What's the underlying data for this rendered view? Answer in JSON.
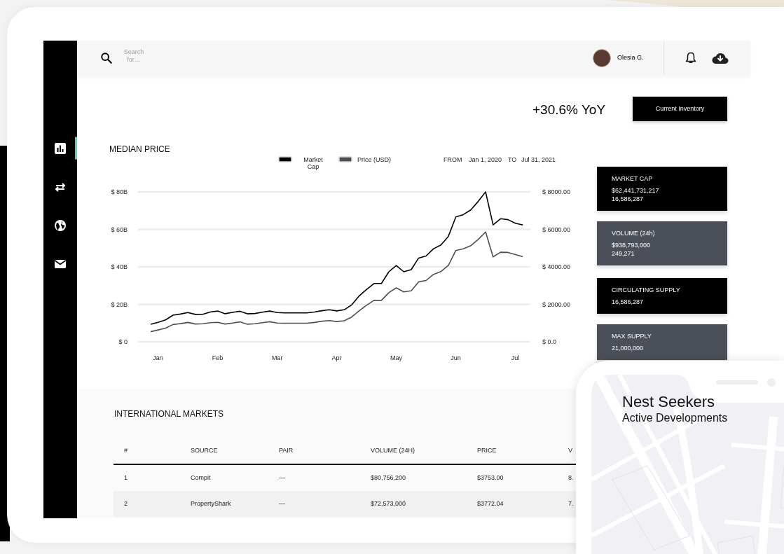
{
  "header": {
    "search": {
      "placeholder": "Search for…"
    },
    "user": {
      "name": "Olesia G."
    }
  },
  "sidebar": {
    "items": [
      {
        "kind": "chart",
        "selected": true
      },
      {
        "kind": "transfer",
        "selected": false
      },
      {
        "kind": "globe",
        "selected": false
      },
      {
        "kind": "mail",
        "selected": false
      }
    ]
  },
  "summary": {
    "change": "+30.6% YoY",
    "button": "Current Inventory"
  },
  "chart": {
    "title": "MEDIAN PRICE",
    "range": {
      "from_label": "FROM",
      "from": "Jan 1, 2020",
      "to_label": "TO",
      "to": "Jul 31, 2021"
    },
    "chart_data": {
      "type": "line",
      "grid": true,
      "legend": true,
      "categories": [
        null,
        "Jan",
        null,
        null,
        null,
        null,
        null,
        null,
        null,
        "Feb",
        null,
        null,
        null,
        null,
        null,
        null,
        null,
        "Mar",
        null,
        null,
        null,
        null,
        null,
        null,
        null,
        "Apr",
        null,
        null,
        null,
        null,
        null,
        null,
        null,
        "May",
        null,
        null,
        null,
        null,
        null,
        null,
        null,
        "Jun",
        null,
        null,
        null,
        null,
        null,
        null,
        null,
        "Jul",
        null
      ],
      "series": [
        {
          "name": "Market Cap",
          "color": "#000000",
          "values": [
            9.3,
            10.4,
            11.7,
            14.2,
            14.8,
            15.6,
            14.6,
            14.7,
            15.9,
            16.4,
            15.0,
            15.7,
            16.3,
            14.9,
            15.1,
            15.8,
            16.4,
            15.6,
            15.4,
            15.4,
            15.4,
            15.4,
            15.9,
            16.6,
            17.1,
            16.5,
            17.1,
            19.7,
            24.4,
            27.9,
            31.1,
            31.1,
            37.4,
            40.7,
            37.4,
            38.5,
            44.7,
            45.8,
            49.7,
            51.7,
            56.3,
            66.6,
            67.9,
            70.4,
            74.9,
            80.0,
            62.4,
            65.7,
            65.2,
            63.3,
            62.3
          ]
        },
        {
          "name": "Price (USD)",
          "color": "#4b5058",
          "axis": "y2",
          "values": [
            540,
            630,
            730,
            920,
            970,
            1030,
            950,
            960,
            1020,
            1040,
            950,
            1000,
            1060,
            940,
            960,
            1020,
            1070,
            1000,
            990,
            990,
            990,
            990,
            1030,
            1100,
            1130,
            1080,
            1120,
            1320,
            1650,
            1950,
            2210,
            2210,
            2620,
            2880,
            2660,
            2720,
            3200,
            3270,
            3600,
            3750,
            4080,
            4870,
            4960,
            5130,
            5460,
            5860,
            4530,
            4780,
            4770,
            4650,
            4540
          ]
        }
      ],
      "ylim": [
        0,
        80
      ],
      "yticks": [
        {
          "value": 0,
          "label": "$ 0"
        },
        {
          "value": 20,
          "label": "$ 20B"
        },
        {
          "value": 40,
          "label": "$ 40B"
        },
        {
          "value": 60,
          "label": "$ 60B"
        },
        {
          "value": 80,
          "label": "$ 80B"
        }
      ],
      "y2lim": [
        0,
        8000
      ],
      "y2ticks": [
        {
          "value": 0,
          "label": "$ 0.0"
        },
        {
          "value": 2000,
          "label": "$ 2000.00"
        },
        {
          "value": 4000,
          "label": "$ 4000.00"
        },
        {
          "value": 6000,
          "label": "$ 6000.00"
        },
        {
          "value": 8000,
          "label": "$ 8000.00"
        }
      ]
    }
  },
  "stats": [
    {
      "label": "MARKET CAP",
      "lines": [
        "$62,441,731,217",
        "16,586,287"
      ],
      "color": "#000000"
    },
    {
      "label": "VOLUME (24h)",
      "lines": [
        "$938,793,000",
        "249,271"
      ],
      "color": "#4b4f58"
    },
    {
      "label": "CIRCULATING SUPPLY",
      "lines": [
        "16,586,287"
      ],
      "color": "#000000"
    },
    {
      "label": "MAX SUPPLY",
      "lines": [
        "21,000,000"
      ],
      "color": "#4b4f58"
    }
  ],
  "markets": {
    "title": "INTERNATIONAL MARKETS",
    "table": {
      "columns": [
        "#",
        "SOURCE",
        "PAIR",
        "VOLUME (24H)",
        "PRICE",
        "V"
      ],
      "rows": [
        [
          "1",
          "Compit",
          "—",
          "$80,756,200",
          "$3753.00",
          "8."
        ],
        [
          "2",
          "PropertyShark",
          "—",
          "$72,573,000",
          "$3772.04",
          "7."
        ]
      ]
    }
  },
  "phone": {
    "title": "Nest Seekers",
    "subtitle": "Active Developments"
  }
}
